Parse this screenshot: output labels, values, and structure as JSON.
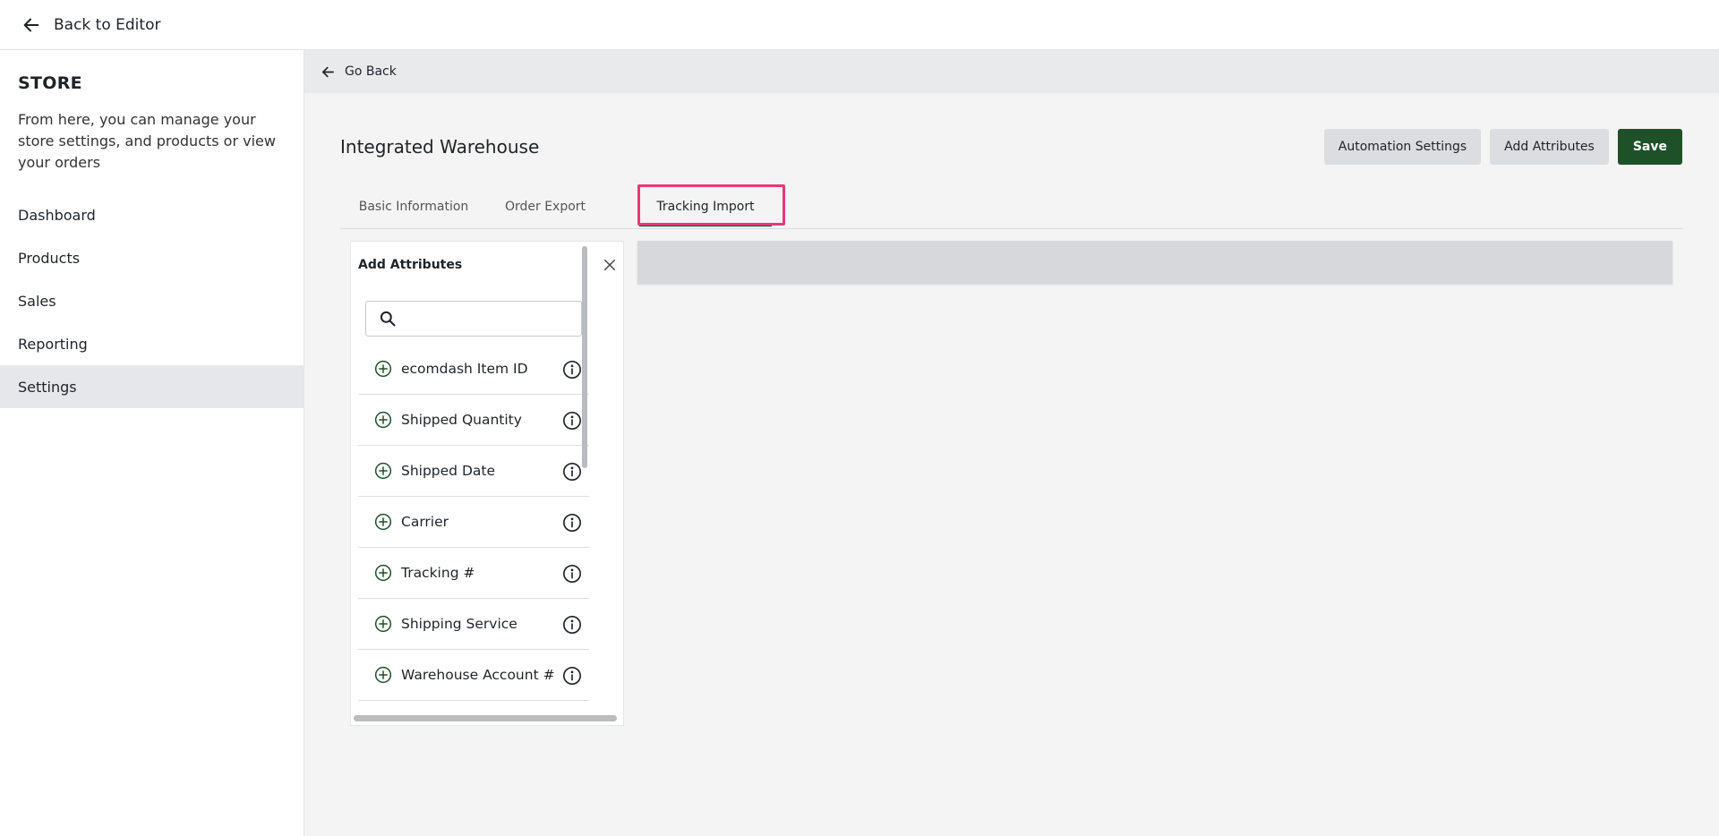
{
  "topbar": {
    "back_label": "Back to Editor"
  },
  "sidebar": {
    "title": "STORE",
    "description": "From here, you can manage your store settings, and products or view your orders",
    "items": [
      {
        "label": "Dashboard",
        "active": false
      },
      {
        "label": "Products",
        "active": false
      },
      {
        "label": "Sales",
        "active": false
      },
      {
        "label": "Reporting",
        "active": false
      },
      {
        "label": "Settings",
        "active": true
      }
    ]
  },
  "main": {
    "go_back_label": "Go Back",
    "title": "Integrated Warehouse",
    "actions": {
      "automation_label": "Automation Settings",
      "add_attributes_label": "Add Attributes",
      "save_label": "Save"
    },
    "tabs": [
      {
        "label": "Basic Information"
      },
      {
        "label": "Order Export"
      },
      {
        "label": "Tracking Import",
        "active": true
      }
    ]
  },
  "attributes_panel": {
    "title": "Add Attributes",
    "search_placeholder": "",
    "search_value": "",
    "items": [
      {
        "label": "ecomdash Item ID"
      },
      {
        "label": "Shipped Quantity"
      },
      {
        "label": "Shipped Date"
      },
      {
        "label": "Carrier"
      },
      {
        "label": "Tracking #"
      },
      {
        "label": "Shipping Service"
      },
      {
        "label": "Warehouse Account #"
      }
    ]
  },
  "colors": {
    "accent_green": "#1e5128",
    "highlight_pink": "#e8387a",
    "active_nav_bg": "#e6e7ea"
  },
  "icons": [
    "arrow-left-icon",
    "close-icon",
    "search-icon",
    "plus-circle-icon",
    "info-icon"
  ]
}
